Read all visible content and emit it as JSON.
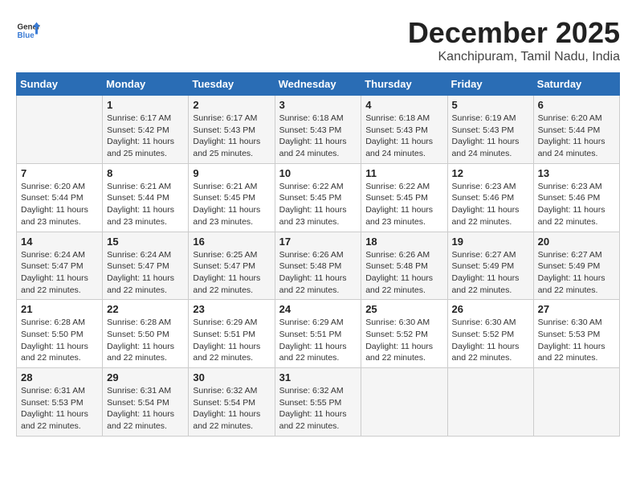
{
  "header": {
    "logo": {
      "general": "General",
      "blue": "Blue"
    },
    "title": "December 2025",
    "location": "Kanchipuram, Tamil Nadu, India"
  },
  "weekdays": [
    "Sunday",
    "Monday",
    "Tuesday",
    "Wednesday",
    "Thursday",
    "Friday",
    "Saturday"
  ],
  "weeks": [
    [
      null,
      {
        "day": "1",
        "sunrise": "6:17 AM",
        "sunset": "5:42 PM",
        "daylight": "11 hours and 25 minutes."
      },
      {
        "day": "2",
        "sunrise": "6:17 AM",
        "sunset": "5:43 PM",
        "daylight": "11 hours and 25 minutes."
      },
      {
        "day": "3",
        "sunrise": "6:18 AM",
        "sunset": "5:43 PM",
        "daylight": "11 hours and 24 minutes."
      },
      {
        "day": "4",
        "sunrise": "6:18 AM",
        "sunset": "5:43 PM",
        "daylight": "11 hours and 24 minutes."
      },
      {
        "day": "5",
        "sunrise": "6:19 AM",
        "sunset": "5:43 PM",
        "daylight": "11 hours and 24 minutes."
      },
      {
        "day": "6",
        "sunrise": "6:20 AM",
        "sunset": "5:44 PM",
        "daylight": "11 hours and 24 minutes."
      }
    ],
    [
      {
        "day": "7",
        "sunrise": "6:20 AM",
        "sunset": "5:44 PM",
        "daylight": "11 hours and 23 minutes."
      },
      {
        "day": "8",
        "sunrise": "6:21 AM",
        "sunset": "5:44 PM",
        "daylight": "11 hours and 23 minutes."
      },
      {
        "day": "9",
        "sunrise": "6:21 AM",
        "sunset": "5:45 PM",
        "daylight": "11 hours and 23 minutes."
      },
      {
        "day": "10",
        "sunrise": "6:22 AM",
        "sunset": "5:45 PM",
        "daylight": "11 hours and 23 minutes."
      },
      {
        "day": "11",
        "sunrise": "6:22 AM",
        "sunset": "5:45 PM",
        "daylight": "11 hours and 23 minutes."
      },
      {
        "day": "12",
        "sunrise": "6:23 AM",
        "sunset": "5:46 PM",
        "daylight": "11 hours and 22 minutes."
      },
      {
        "day": "13",
        "sunrise": "6:23 AM",
        "sunset": "5:46 PM",
        "daylight": "11 hours and 22 minutes."
      }
    ],
    [
      {
        "day": "14",
        "sunrise": "6:24 AM",
        "sunset": "5:47 PM",
        "daylight": "11 hours and 22 minutes."
      },
      {
        "day": "15",
        "sunrise": "6:24 AM",
        "sunset": "5:47 PM",
        "daylight": "11 hours and 22 minutes."
      },
      {
        "day": "16",
        "sunrise": "6:25 AM",
        "sunset": "5:47 PM",
        "daylight": "11 hours and 22 minutes."
      },
      {
        "day": "17",
        "sunrise": "6:26 AM",
        "sunset": "5:48 PM",
        "daylight": "11 hours and 22 minutes."
      },
      {
        "day": "18",
        "sunrise": "6:26 AM",
        "sunset": "5:48 PM",
        "daylight": "11 hours and 22 minutes."
      },
      {
        "day": "19",
        "sunrise": "6:27 AM",
        "sunset": "5:49 PM",
        "daylight": "11 hours and 22 minutes."
      },
      {
        "day": "20",
        "sunrise": "6:27 AM",
        "sunset": "5:49 PM",
        "daylight": "11 hours and 22 minutes."
      }
    ],
    [
      {
        "day": "21",
        "sunrise": "6:28 AM",
        "sunset": "5:50 PM",
        "daylight": "11 hours and 22 minutes."
      },
      {
        "day": "22",
        "sunrise": "6:28 AM",
        "sunset": "5:50 PM",
        "daylight": "11 hours and 22 minutes."
      },
      {
        "day": "23",
        "sunrise": "6:29 AM",
        "sunset": "5:51 PM",
        "daylight": "11 hours and 22 minutes."
      },
      {
        "day": "24",
        "sunrise": "6:29 AM",
        "sunset": "5:51 PM",
        "daylight": "11 hours and 22 minutes."
      },
      {
        "day": "25",
        "sunrise": "6:30 AM",
        "sunset": "5:52 PM",
        "daylight": "11 hours and 22 minutes."
      },
      {
        "day": "26",
        "sunrise": "6:30 AM",
        "sunset": "5:52 PM",
        "daylight": "11 hours and 22 minutes."
      },
      {
        "day": "27",
        "sunrise": "6:30 AM",
        "sunset": "5:53 PM",
        "daylight": "11 hours and 22 minutes."
      }
    ],
    [
      {
        "day": "28",
        "sunrise": "6:31 AM",
        "sunset": "5:53 PM",
        "daylight": "11 hours and 22 minutes."
      },
      {
        "day": "29",
        "sunrise": "6:31 AM",
        "sunset": "5:54 PM",
        "daylight": "11 hours and 22 minutes."
      },
      {
        "day": "30",
        "sunrise": "6:32 AM",
        "sunset": "5:54 PM",
        "daylight": "11 hours and 22 minutes."
      },
      {
        "day": "31",
        "sunrise": "6:32 AM",
        "sunset": "5:55 PM",
        "daylight": "11 hours and 22 minutes."
      },
      null,
      null,
      null
    ]
  ]
}
